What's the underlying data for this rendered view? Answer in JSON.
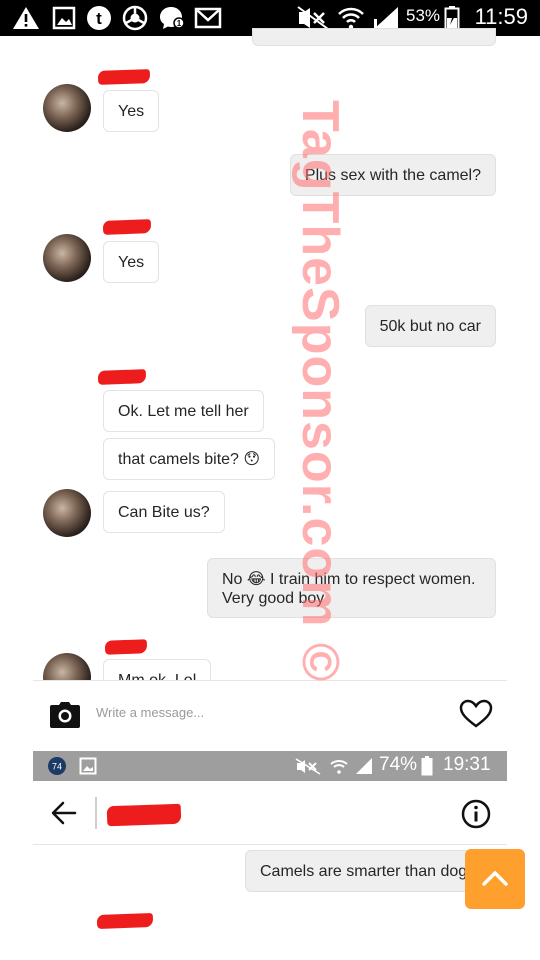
{
  "status_bar": {
    "signal_percent": "53%",
    "time": "11:59",
    "icons": [
      "warning-icon",
      "image-icon",
      "tumblr-icon",
      "chrome-icon",
      "messenger-icon",
      "gmail-icon",
      "mute-icon",
      "wifi-icon",
      "signal-icon",
      "battery-icon"
    ]
  },
  "chat": {
    "messages": [
      {
        "side": "in",
        "text": "Yes"
      },
      {
        "side": "out",
        "text": "Plus sex with the camel?"
      },
      {
        "side": "in",
        "text": "Yes"
      },
      {
        "side": "out",
        "text": "50k but no car"
      },
      {
        "side": "in",
        "text": "Ok. Let me tell her"
      },
      {
        "side": "in",
        "text": "that camels bite? 😯"
      },
      {
        "side": "in",
        "text": "Can Bite us?"
      },
      {
        "side": "out",
        "text": "No 😂 I train him to respect women. Very good boy"
      },
      {
        "side": "in",
        "text": "Mm ok. Lol"
      }
    ],
    "composer_placeholder": "Write a message..."
  },
  "second_screen": {
    "status_bar": {
      "badge": "74",
      "battery_percent": "74%",
      "time": "19:31"
    },
    "first_message": "Camels are smarter than dogs"
  },
  "watermark": "TagTheSponsor.com ©",
  "colors": {
    "redaction": "#ee1d1d",
    "scroll_button": "#ffa02e",
    "outgoing_bubble": "#efefef"
  }
}
